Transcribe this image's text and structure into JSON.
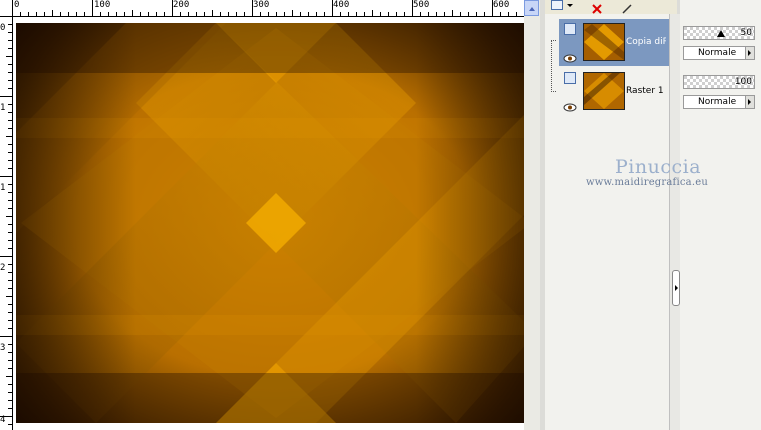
{
  "ruler": {
    "top_labels": [
      "0",
      "100",
      "200",
      "300",
      "400",
      "500",
      "600"
    ],
    "left_labels": [
      "0",
      "1",
      "1",
      "2",
      "3",
      "4"
    ]
  },
  "layers": [
    {
      "name": "Copia diRaster",
      "selected": true
    },
    {
      "name": "Raster 1",
      "selected": false
    }
  ],
  "props": [
    {
      "opacity": "50",
      "blend": "Normale"
    },
    {
      "opacity": "100",
      "blend": "Normale"
    }
  ],
  "watermark": {
    "name": "Pinuccia",
    "site": "www.maidiregrafica.eu"
  },
  "colors": {
    "accent": "#e08a00",
    "dark": "#2a1500",
    "selection": "#7c98c0",
    "titlebar": "#0a46d6"
  }
}
